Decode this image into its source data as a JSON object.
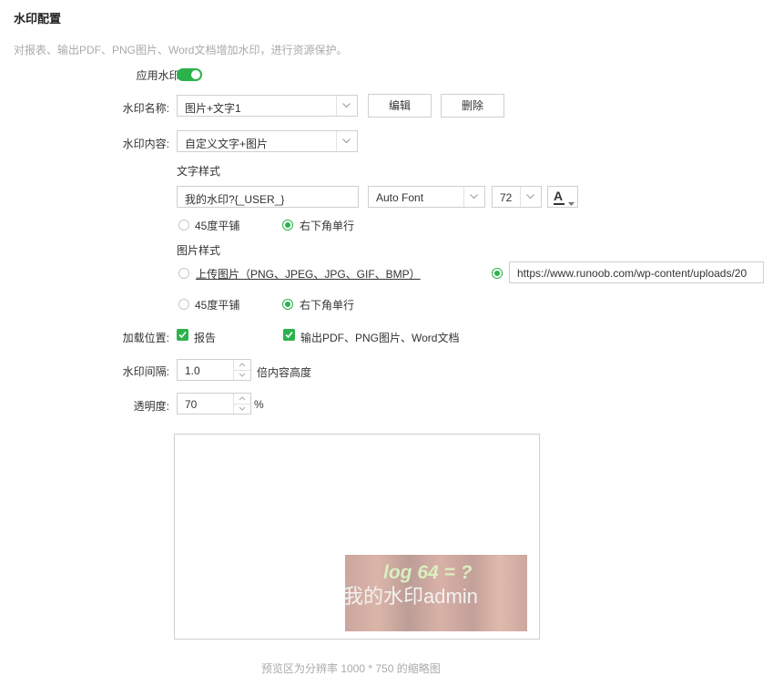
{
  "page": {
    "title": "水印配置",
    "description": "对报表、输出PDF、PNG图片、Word文档增加水印，进行资源保护。"
  },
  "watermark_enable": {
    "label": "应用水印:",
    "enabled": true
  },
  "watermark_name": {
    "label": "水印名称:",
    "value": "图片+文字1",
    "edit_label": "编辑",
    "delete_label": "删除"
  },
  "watermark_content": {
    "label": "水印内容:",
    "value": "自定义文字+图片"
  },
  "text_style": {
    "heading": "文字样式",
    "text_value": "我的水印?{_USER_}",
    "font": "Auto Font",
    "font_size": "72",
    "font_color_glyph": "A",
    "layout_option_tiled": "45度平铺",
    "layout_option_corner": "右下角单行",
    "selected_layout": "corner"
  },
  "image_style": {
    "heading": "图片样式",
    "upload_label": "上传图片（PNG、JPEG、JPG、GIF、BMP）",
    "url_value": "https://www.runoob.com/wp-content/uploads/20",
    "selected_source": "url",
    "layout_option_tiled": "45度平铺",
    "layout_option_corner": "右下角单行",
    "selected_layout": "corner"
  },
  "load_position": {
    "label": "加载位置:",
    "option_report": "报告",
    "option_export": "输出PDF、PNG图片、Word文档",
    "report_checked": true,
    "export_checked": true
  },
  "spacing": {
    "label": "水印间隔:",
    "value": "1.0",
    "suffix": "倍内容高度"
  },
  "opacity": {
    "label": "透明度:",
    "value": "70",
    "suffix": "%"
  },
  "preview": {
    "formula_text": "log 64 = ?",
    "watermark_text": "我的水印admin",
    "caption": "预览区为分辨率 1000 * 750 的缩略图"
  },
  "colors": {
    "accent": "#2bb24c",
    "border": "#cfcfcf",
    "muted_text": "#aaaaaa"
  }
}
